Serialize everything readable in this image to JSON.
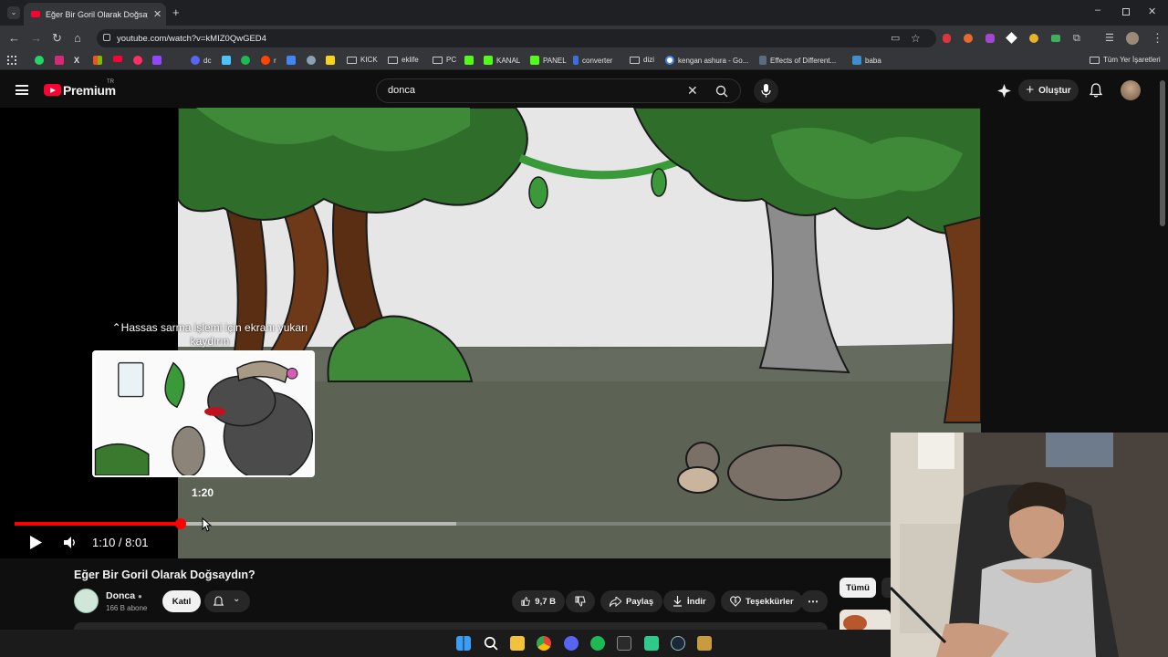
{
  "browser": {
    "tab_title": "Eğer Bir Goril Olarak Doğsaydın",
    "url": "youtube.com/watch?v=kMIZ0QwGED4",
    "bookmarks": [
      {
        "label": "dc"
      },
      {
        "label": "r"
      },
      {
        "label": "KICK"
      },
      {
        "label": "eklife"
      },
      {
        "label": "PC"
      },
      {
        "label": "KANAL"
      },
      {
        "label": "PANEL"
      },
      {
        "label": "converter"
      },
      {
        "label": "dizi"
      },
      {
        "label": "kengan ashura - Go..."
      },
      {
        "label": "Effects of Different..."
      },
      {
        "label": "baba"
      }
    ],
    "all_bookmarks": "Tüm Yer İşaretleri"
  },
  "youtube": {
    "brand": "Premium",
    "region": "TR",
    "search_value": "donca",
    "create_label": "Oluştur"
  },
  "player": {
    "seek_hint_line1": "Hassas sarma işlemi için ekranı yukarı",
    "seek_hint_line2": "kaydırın",
    "preview_time": "1:20",
    "time_display": "1:10 / 8:01",
    "played_fraction": 0.1746,
    "buffered_fraction": 0.465
  },
  "video": {
    "title": "Eğer Bir Goril Olarak Doğsaydın?",
    "channel": "Donca",
    "subscribers": "166 B abone",
    "join_label": "Katıl",
    "likes": "9,7 B",
    "share_label": "Paylaş",
    "download_label": "İndir",
    "thanks_label": "Teşekkürler"
  },
  "sidebar": {
    "chip_all": "Tümü"
  },
  "colors": {
    "accent": "#ff0033",
    "progress_red": "#ff0000",
    "background": "#0f0f0f"
  }
}
